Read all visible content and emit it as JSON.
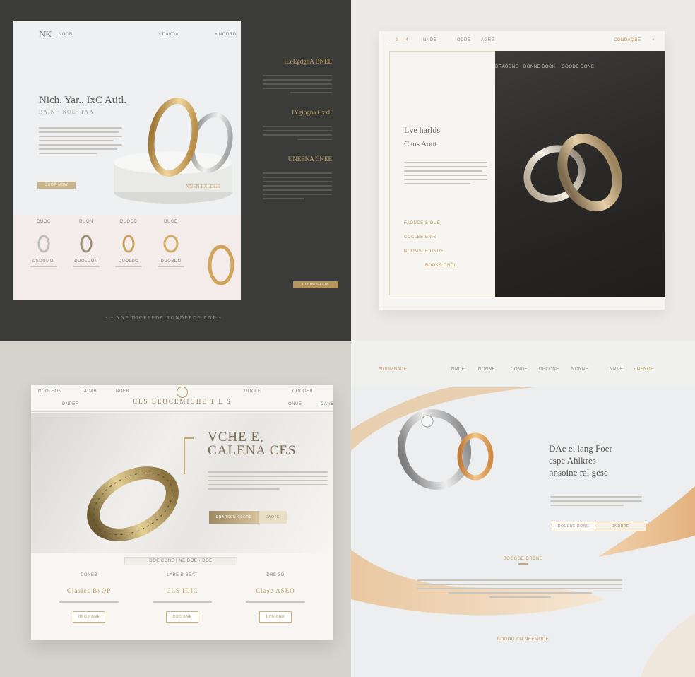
{
  "q1": {
    "logo": "NK",
    "nav": [
      "NOOB",
      "• DAVOA",
      "• NOORD"
    ],
    "hero_title": "Nich. Yar.. IxC Atitl.",
    "hero_sub": "BAIN · NOE· TAA",
    "hero_button": "SHOP NOW",
    "plinth_label": "NNEN EXLDLE",
    "products": [
      {
        "name": "DUOC",
        "label": "DSDUMOI"
      },
      {
        "name": "DUON",
        "label": "DUOLDON"
      },
      {
        "name": "DUODD",
        "label": "DUOLDO"
      },
      {
        "name": "DUOD",
        "label": "DUOBDN"
      },
      {
        "name": "",
        "label": ""
      }
    ],
    "side": [
      {
        "title": "ILeEgdgnA BNEE"
      },
      {
        "title": "IYgiogna CxxE"
      },
      {
        "title": "UNEENA CNEE"
      }
    ],
    "side_button": "COUNDFOON",
    "footer": "•  •  NNE  DICEEFDE  RONDEEDE  RNE  •"
  },
  "q2": {
    "nav": [
      "— 2 — 4",
      "NNDE",
      "ODDE",
      "AGRE",
      "CONDAQBE"
    ],
    "photo_nav": [
      "DRABONE",
      "DONNE BOCK",
      "OOODE DONE"
    ],
    "title1": "Lve harlds",
    "title2": "Cans Aont",
    "links": [
      "FAONCE  SIOUE",
      "COCLEE  BNIE",
      "NOOMSUE  DNLG"
    ],
    "link_more": "BOOKS DNOL"
  },
  "q3": {
    "bar1": [
      "NOOLEON",
      "DADAB",
      "NOEB",
      "DOOLE",
      "DOODEB"
    ],
    "brand": "CLS  BEOCEMIGHE T L S",
    "bar2": [
      "DNPER",
      "ONUE",
      "CANS"
    ],
    "hero_title_1": "VCHE E,",
    "hero_title_2": "CALENA CES",
    "hero_btn1": "DRARSEN CEERE",
    "hero_btn2": "EAOTE",
    "pager": "DOE    CDNE  |  NE DOE  •  DOE",
    "cols": [
      {
        "head": "DONEB",
        "name": "Clasics  BxQP",
        "button": "DNOE   BNE"
      },
      {
        "head": "LABE  B  BEAT",
        "name": "CLS IDIC",
        "button": "DOC   BNE"
      },
      {
        "head": "DRE  3O",
        "name": "Clase  ASEO",
        "button": "DNE   BNE"
      }
    ]
  },
  "q4": {
    "nav": [
      "NOOMNADE",
      "NNDE",
      "NONNE",
      "CONDE",
      "DECONE",
      "NONNE",
      "NNNE",
      "• NENOE"
    ],
    "title": [
      "DAe ei lang Foer",
      "cspe Ahlkres",
      "nnsoine ral gese"
    ],
    "btn1": "DOUDNE DONC",
    "btn2": "DNDDRE",
    "mid_heading": "BOOOGE DRDNE",
    "bottom_heading": "BOOOG  CN  NEEMOOE"
  }
}
